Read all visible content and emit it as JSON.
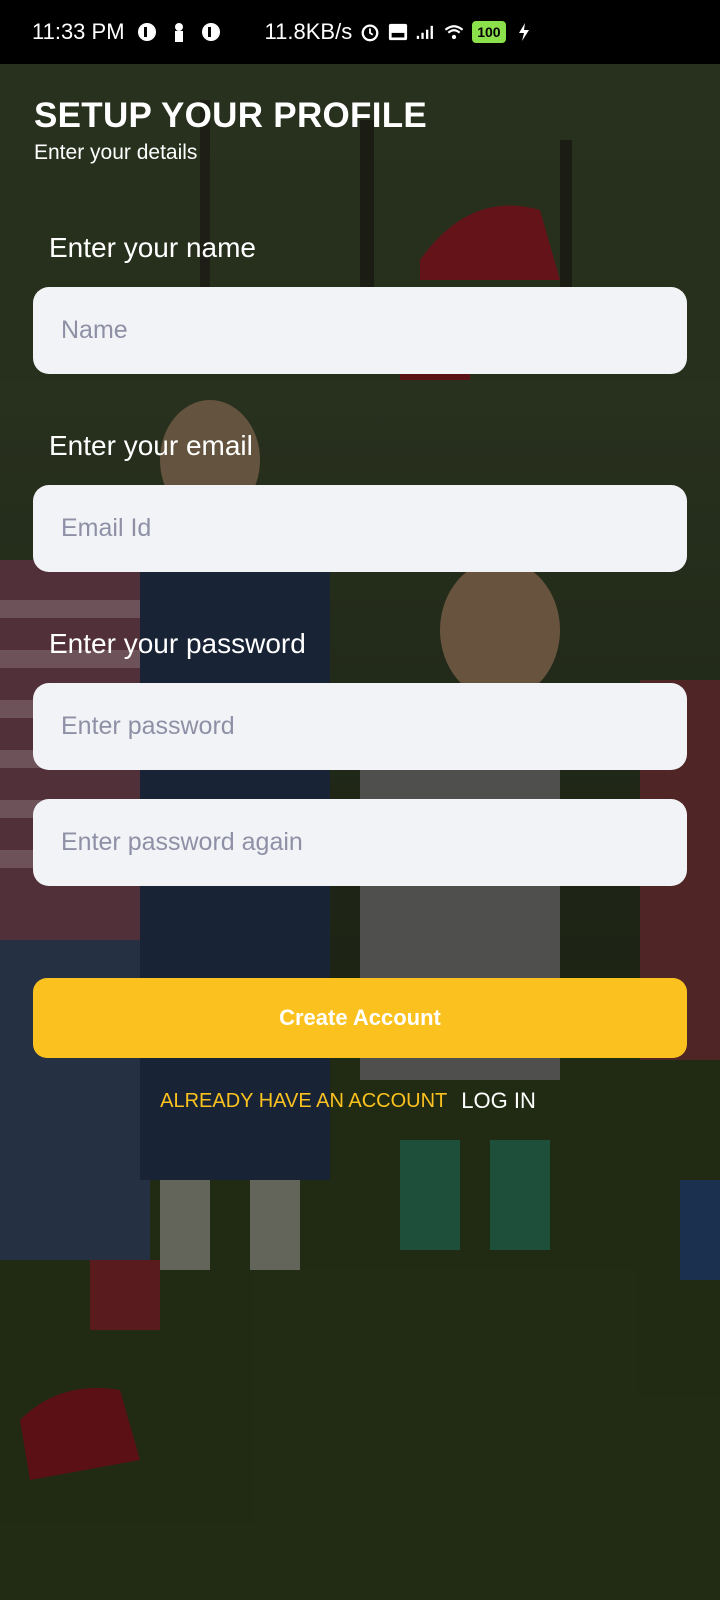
{
  "status_bar": {
    "time": "11:33 PM",
    "speed": "11.8KB/s",
    "battery": "100",
    "icons": [
      "notification-icon",
      "person-icon",
      "notification-icon",
      "alarm-icon",
      "volte-icon",
      "signal-icon",
      "wifi-icon",
      "battery-icon",
      "charging-icon"
    ]
  },
  "header": {
    "title": "SETUP YOUR PROFILE",
    "subtitle": "Enter your details"
  },
  "form": {
    "name_label": "Enter your name",
    "name_placeholder": "Name",
    "email_label": "Enter your email",
    "email_placeholder": "Email Id",
    "password_label": "Enter your password",
    "password_placeholder": "Enter password",
    "password_again_placeholder": "Enter password again",
    "create_button": "Create Account"
  },
  "footer": {
    "already_text": "ALREADY HAVE AN ACCOUNT",
    "login_text": "LOG IN"
  },
  "colors": {
    "accent": "#fbc21f",
    "input_bg": "#f2f3f7",
    "placeholder": "#8f90a6"
  }
}
